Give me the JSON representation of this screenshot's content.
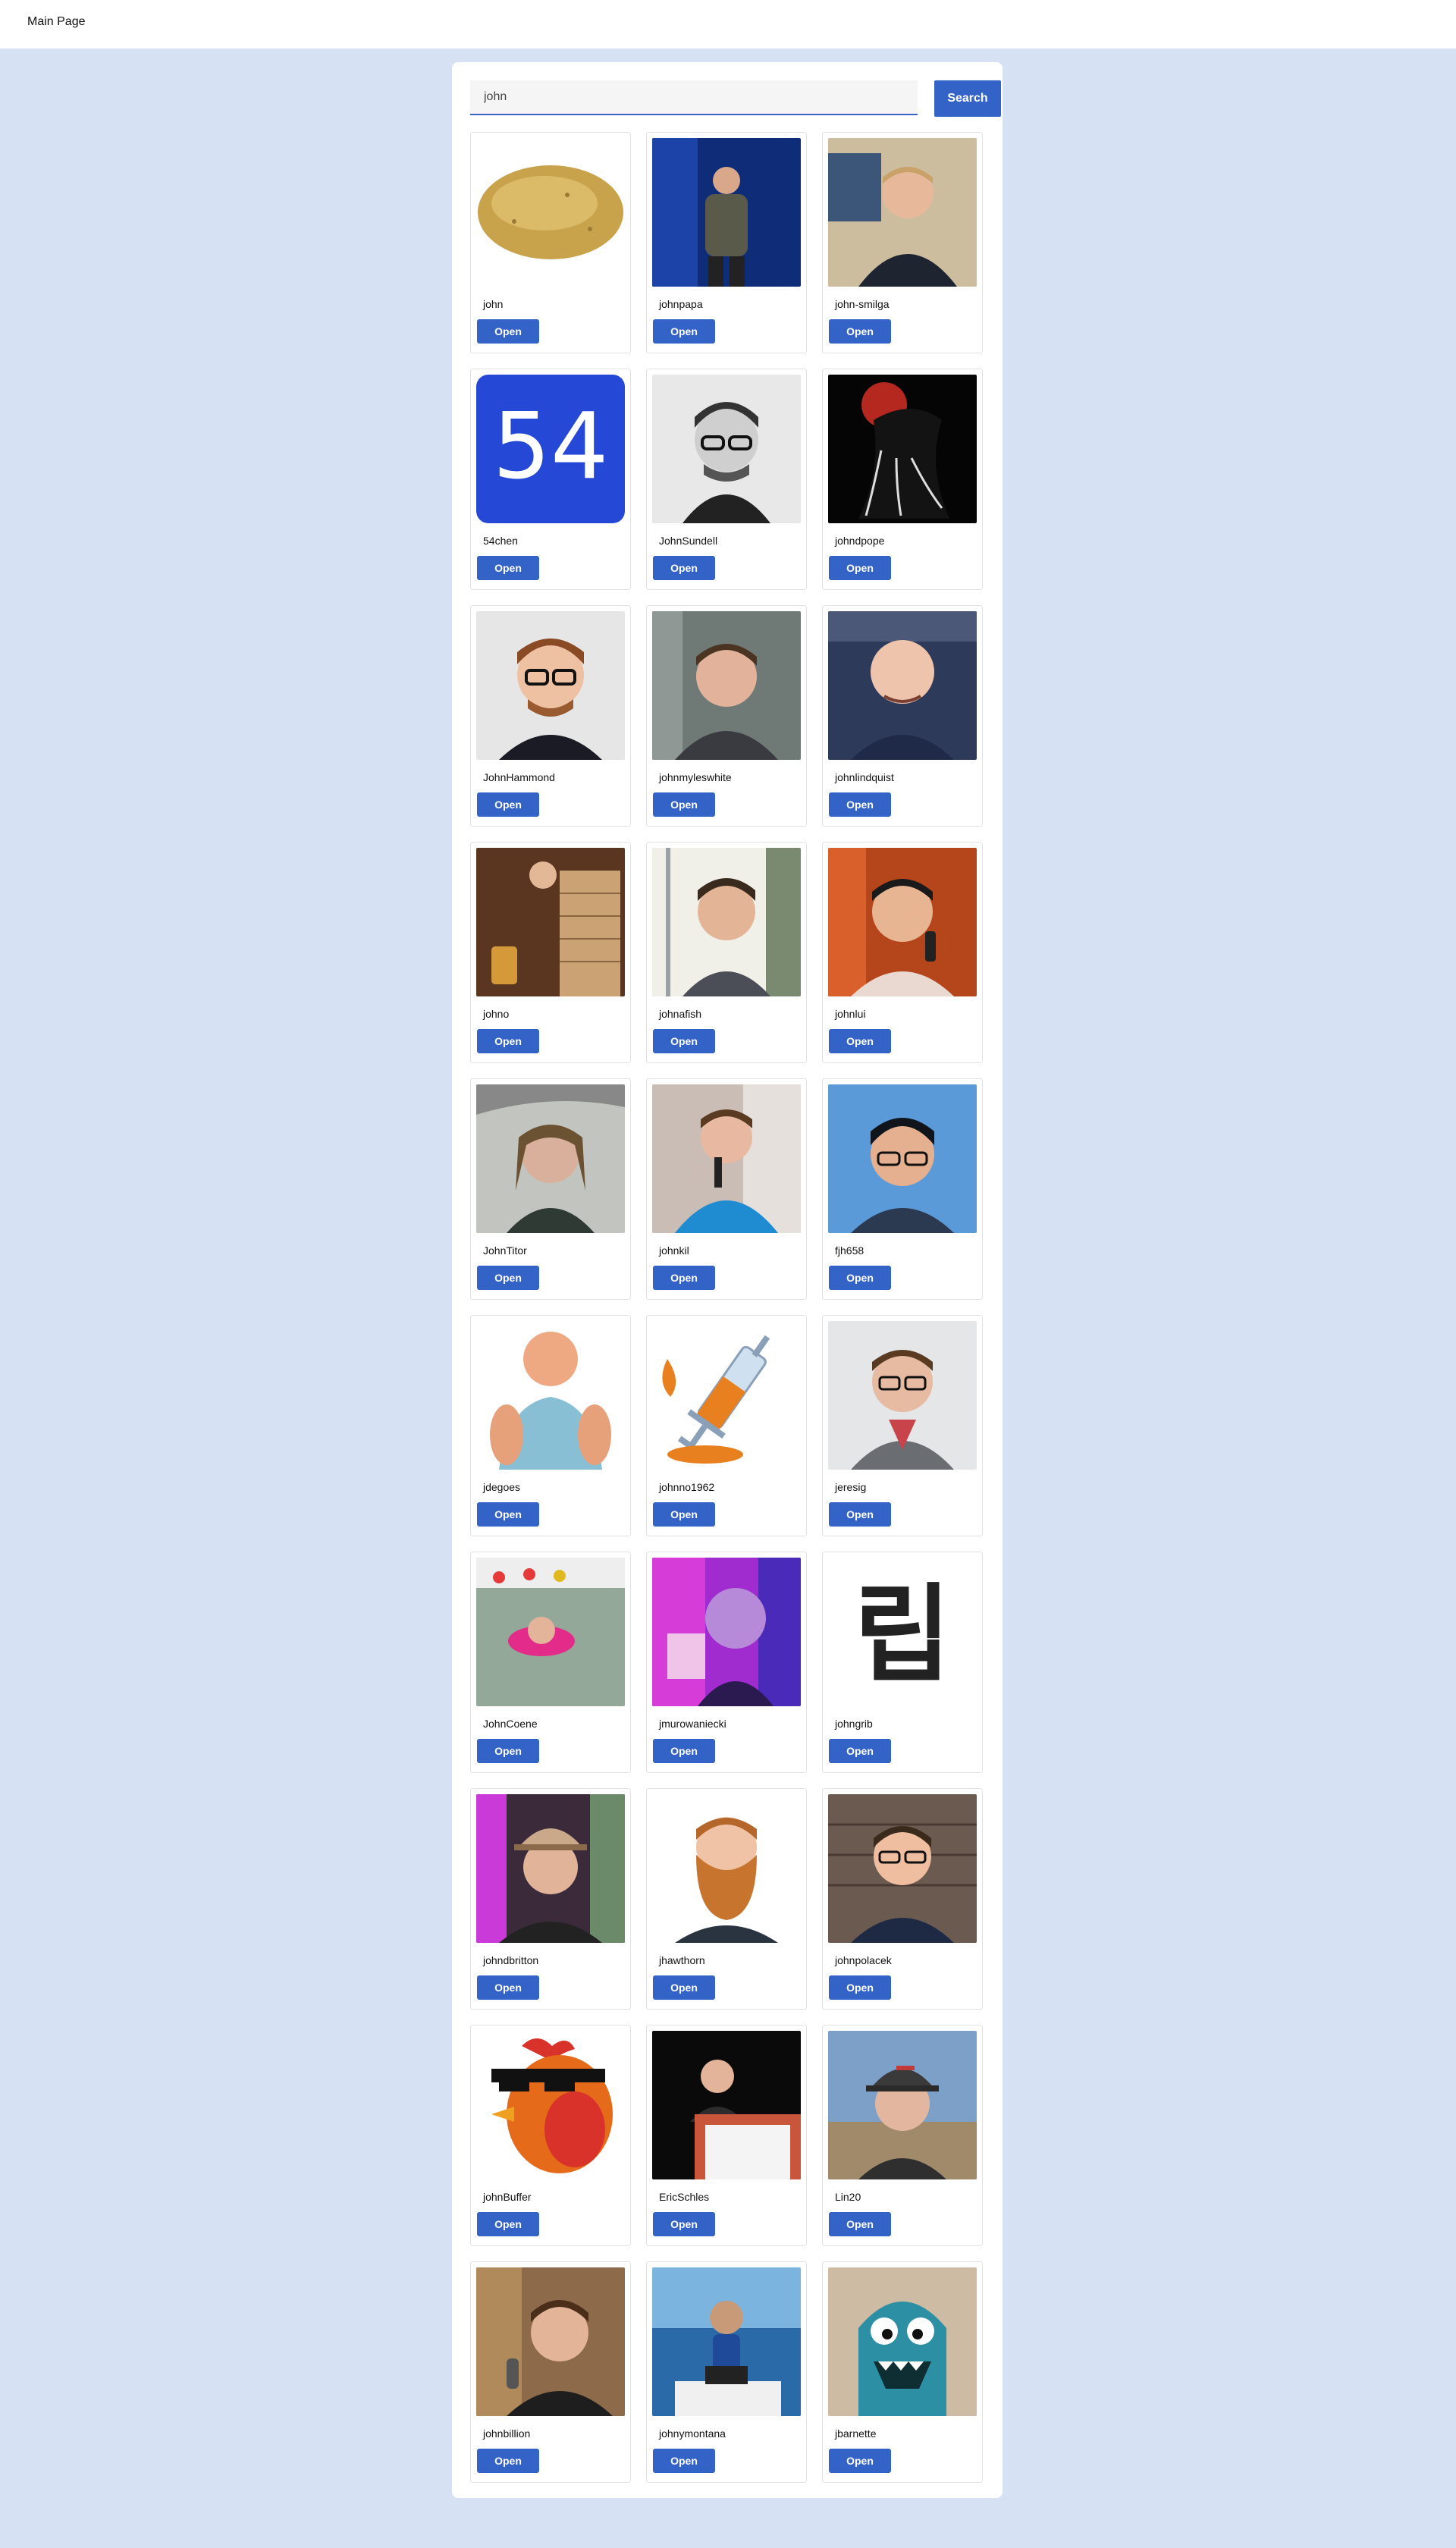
{
  "nav": {
    "home_label": "Main Page"
  },
  "search": {
    "value": "john",
    "button_label": "Search"
  },
  "users": [
    {
      "username": "john",
      "avatar": "potato"
    },
    {
      "username": "johnpapa",
      "avatar": "speaker-photo"
    },
    {
      "username": "john-smilga",
      "avatar": "smiling-man-photo"
    },
    {
      "username": "54chen",
      "avatar": "number-54-logo",
      "avatar_text": "54"
    },
    {
      "username": "JohnSundell",
      "avatar": "bw-glasses-photo"
    },
    {
      "username": "johndpope",
      "avatar": "dark-cartoon"
    },
    {
      "username": "JohnHammond",
      "avatar": "glasses-man-photo"
    },
    {
      "username": "johnmyleswhite",
      "avatar": "hoodie-man-photo"
    },
    {
      "username": "johnlindquist",
      "avatar": "bald-man-photo"
    },
    {
      "username": "johno",
      "avatar": "jenga-photo"
    },
    {
      "username": "johnafish",
      "avatar": "young-man-photo"
    },
    {
      "username": "johnlui",
      "avatar": "phone-man-photo"
    },
    {
      "username": "JohnTitor",
      "avatar": "car-selfie-photo"
    },
    {
      "username": "johnkil",
      "avatar": "blue-jacket-photo"
    },
    {
      "username": "fjh658",
      "avatar": "sky-glasses-photo"
    },
    {
      "username": "jdegoes",
      "avatar": "muscular-render"
    },
    {
      "username": "johnno1962",
      "avatar": "syringe-icon-art"
    },
    {
      "username": "jeresig",
      "avatar": "glasses-gray-photo"
    },
    {
      "username": "JohnCoene",
      "avatar": "pool-float-photo"
    },
    {
      "username": "jmurowaniecki",
      "avatar": "glitch-photo"
    },
    {
      "username": "johngrib",
      "avatar": "hangul-glyph",
      "avatar_text": "립"
    },
    {
      "username": "johndbritton",
      "avatar": "cap-selfie-photo"
    },
    {
      "username": "jhawthorn",
      "avatar": "beard-man-photo"
    },
    {
      "username": "johnpolacek",
      "avatar": "brick-wall-photo"
    },
    {
      "username": "johnBuffer",
      "avatar": "rooster-cartoon"
    },
    {
      "username": "EricSchles",
      "avatar": "podium-photo"
    },
    {
      "username": "Lin20",
      "avatar": "cap-outdoor-photo"
    },
    {
      "username": "johnbillion",
      "avatar": "microphone-photo"
    },
    {
      "username": "johnymontana",
      "avatar": "boat-photo"
    },
    {
      "username": "jbarnette",
      "avatar": "blue-monster-cartoon"
    }
  ],
  "card_button_label": "Open",
  "colors": {
    "accent": "#3463c8",
    "background": "#d6e1f3"
  }
}
